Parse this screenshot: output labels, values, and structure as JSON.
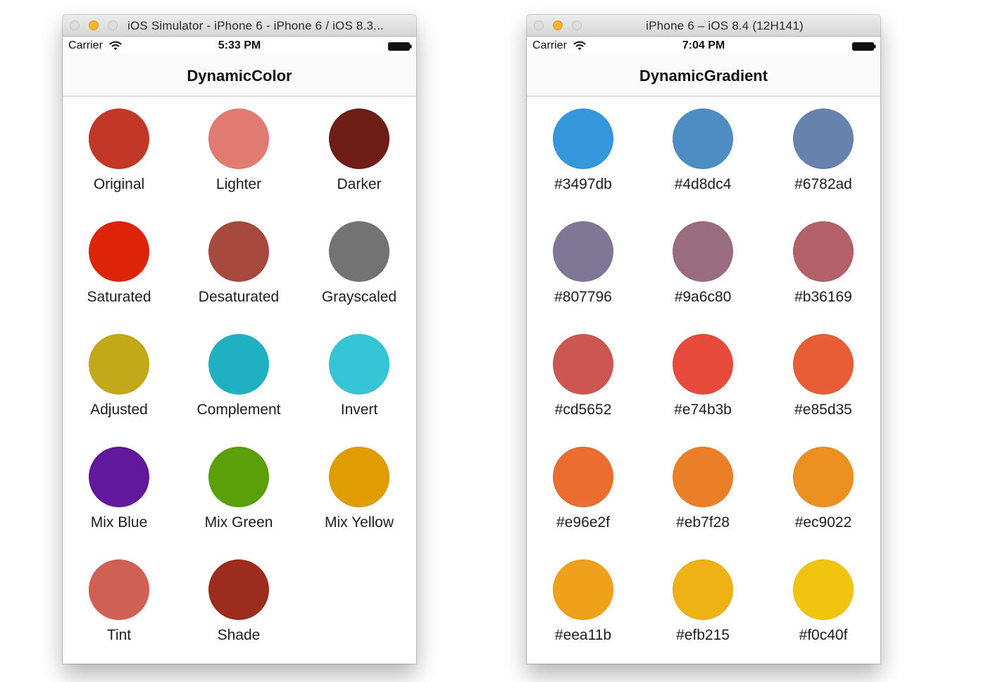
{
  "windows": [
    {
      "window_title": "iOS Simulator - iPhone 6 - iPhone 6 / iOS 8.3...",
      "carrier": "Carrier",
      "time": "5:33 PM",
      "nav_title": "DynamicColor",
      "swatches": [
        {
          "label": "Original",
          "color": "#c23725"
        },
        {
          "label": "Lighter",
          "color": "#e17b72"
        },
        {
          "label": "Darker",
          "color": "#6e1e16"
        },
        {
          "label": "Saturated",
          "color": "#dd2408"
        },
        {
          "label": "Desaturated",
          "color": "#a8493e"
        },
        {
          "label": "Grayscaled",
          "color": "#737373"
        },
        {
          "label": "Adjusted",
          "color": "#c3a918"
        },
        {
          "label": "Complement",
          "color": "#1fb1c2"
        },
        {
          "label": "Invert",
          "color": "#34c6d6"
        },
        {
          "label": "Mix Blue",
          "color": "#61189c"
        },
        {
          "label": "Mix Green",
          "color": "#5b9f0a"
        },
        {
          "label": "Mix Yellow",
          "color": "#e09d03"
        },
        {
          "label": "Tint",
          "color": "#cf6053"
        },
        {
          "label": "Shade",
          "color": "#9b2c1e"
        }
      ]
    },
    {
      "window_title": "iPhone 6 – iOS 8.4 (12H141)",
      "carrier": "Carrier",
      "time": "7:04 PM",
      "nav_title": "DynamicGradient",
      "swatches": [
        {
          "label": "#3497db",
          "color": "#3497db"
        },
        {
          "label": "#4d8dc4",
          "color": "#4d8dc4"
        },
        {
          "label": "#6782ad",
          "color": "#6782ad"
        },
        {
          "label": "#807796",
          "color": "#807796"
        },
        {
          "label": "#9a6c80",
          "color": "#9a6c80"
        },
        {
          "label": "#b36169",
          "color": "#b36169"
        },
        {
          "label": "#cd5652",
          "color": "#cd5652"
        },
        {
          "label": "#e74b3b",
          "color": "#e74b3b"
        },
        {
          "label": "#e85d35",
          "color": "#e85d35"
        },
        {
          "label": "#e96e2f",
          "color": "#e96e2f"
        },
        {
          "label": "#eb7f28",
          "color": "#eb7f28"
        },
        {
          "label": "#ec9022",
          "color": "#ec9022"
        },
        {
          "label": "#eea11b",
          "color": "#eea11b"
        },
        {
          "label": "#efb215",
          "color": "#efb215"
        },
        {
          "label": "#f0c40f",
          "color": "#f0c40f"
        }
      ]
    }
  ]
}
